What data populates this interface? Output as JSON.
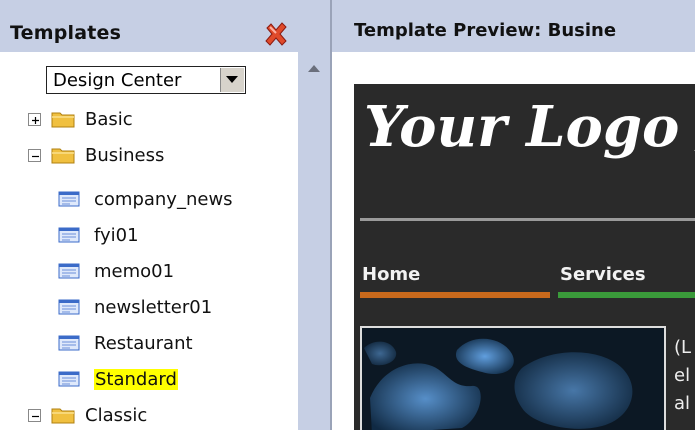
{
  "left_panel": {
    "title": "Templates",
    "combo_value": "Design Center",
    "tree": [
      {
        "label": "Basic",
        "type": "folder",
        "expanded": false
      },
      {
        "label": "Business",
        "type": "folder",
        "expanded": true
      },
      {
        "label": "company_news",
        "type": "template"
      },
      {
        "label": "fyi01",
        "type": "template"
      },
      {
        "label": "memo01",
        "type": "template"
      },
      {
        "label": "newsletter01",
        "type": "template"
      },
      {
        "label": "Restaurant",
        "type": "template"
      },
      {
        "label": "Standard",
        "type": "template",
        "selected": true
      },
      {
        "label": "Classic",
        "type": "folder",
        "expanded": true
      }
    ]
  },
  "right_panel": {
    "title": "Template Preview: Busine",
    "logo_text": "Your Logo /",
    "nav": [
      "Home",
      "Services"
    ],
    "body_text": [
      "(L",
      "el",
      "al"
    ]
  },
  "colors": {
    "header_bg": "#c6cfe4",
    "selection": "#ffff00",
    "nav_home_underline": "#c8691c",
    "nav_services_underline": "#3a9a3a"
  },
  "icons": {
    "close": "close-x-icon",
    "folder": "folder-icon",
    "template": "template-doc-icon",
    "expand": "plus-box-icon",
    "collapse": "minus-box-icon",
    "dropdown": "chevron-down-icon",
    "scroll_up": "scroll-up-arrow-icon"
  }
}
